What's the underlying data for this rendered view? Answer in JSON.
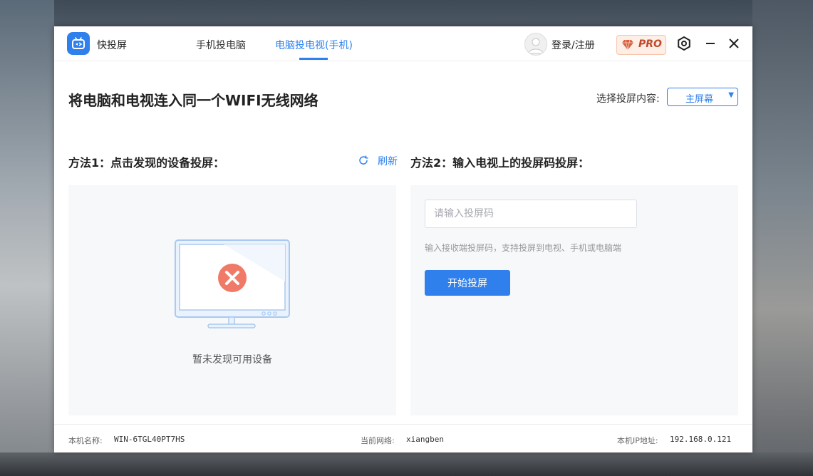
{
  "app": {
    "name": "快投屏"
  },
  "tabs": [
    {
      "label": "手机投电脑",
      "active": false
    },
    {
      "label": "电脑投电视(手机)",
      "active": true
    }
  ],
  "header": {
    "login_label": "登录/注册",
    "pro_label": "PRO"
  },
  "main": {
    "headline": "将电脑和电视连入同一个WIFI无线网络",
    "select_label": "选择投屏内容:",
    "select_value": "主屏幕"
  },
  "method1": {
    "title": "方法1：点击发现的设备投屏：",
    "refresh_label": "刷新",
    "empty_text": "暂未发现可用设备"
  },
  "method2": {
    "title": "方法2：输入电视上的投屏码投屏：",
    "input_placeholder": "请输入投屏码",
    "hint": "输入接收端投屏码，支持投屏到电视、手机或电脑端",
    "start_button": "开始投屏"
  },
  "status": {
    "machine_label": "本机名称:",
    "machine_value": "WIN-6TGL40PT7HS",
    "network_label": "当前网络:",
    "network_value": "xiangben",
    "ip_label": "本机IP地址:",
    "ip_value": "192.168.0.121"
  },
  "colors": {
    "accent": "#2f80ed",
    "error": "#f07a67",
    "pro": "#c0492c"
  },
  "icons": [
    "app-logo-icon",
    "avatar-icon",
    "diamond-icon",
    "settings-icon",
    "minimize-icon",
    "close-icon",
    "refresh-icon",
    "monitor-error-icon"
  ]
}
